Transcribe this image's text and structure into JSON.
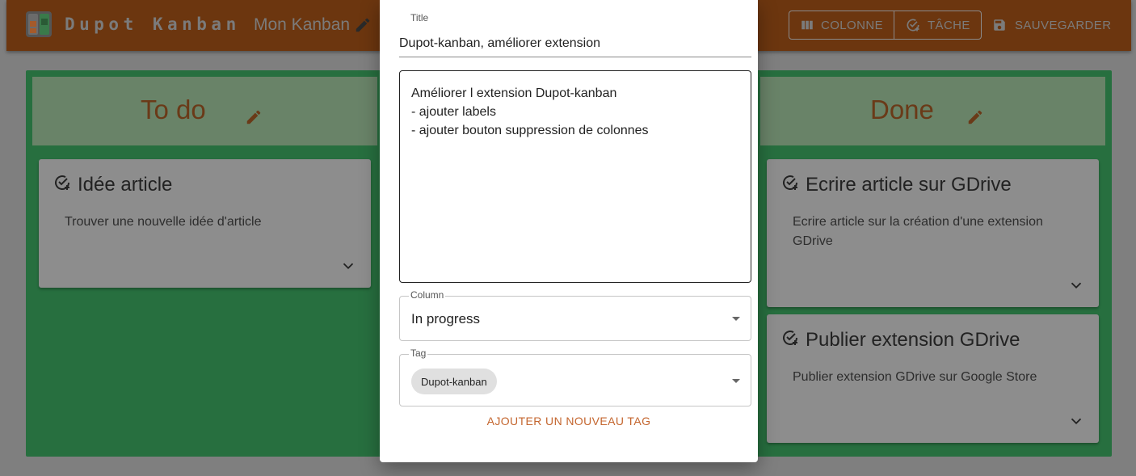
{
  "appbar": {
    "app_title": "Dupot Kanban",
    "board_title": "Mon Kanban",
    "column_button": "COLONNE",
    "task_button": "TÂCHE",
    "save_button": "SAUVEGARDER"
  },
  "columns": [
    {
      "title": "To do",
      "cards": [
        {
          "title": "Idée article",
          "description": "Trouver une nouvelle idée d'article"
        }
      ]
    },
    {
      "title": "Done",
      "cards": [
        {
          "title": "Ecrire article sur GDrive",
          "description_lines": [
            "Ecrire article sur la création d'une extension",
            "GDrive"
          ]
        },
        {
          "title": "Publier extension GDrive",
          "description": "Publier extension GDrive sur Google Store"
        }
      ]
    }
  ],
  "dialog": {
    "title_label": "Title",
    "title_value": "Dupot-kanban, améliorer extension",
    "description_lines": [
      "Améliorer l extension Dupot-kanban",
      "- ajouter labels",
      "- ajouter bouton suppression de colonnes"
    ],
    "column_label": "Column",
    "column_value": "In progress",
    "tag_label": "Tag",
    "tag_chip": "Dupot-kanban",
    "add_tag_button": "AJOUTER UN NOUVEAU TAG"
  },
  "colors": {
    "accent": "#c4662f",
    "board_green": "#276f3f",
    "backdrop": "#7f7f7f"
  }
}
